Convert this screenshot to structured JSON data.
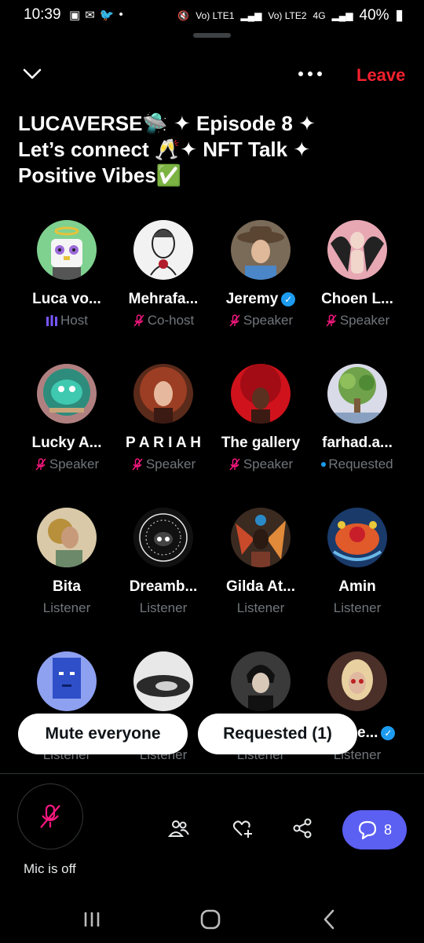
{
  "status_bar": {
    "time": "10:39",
    "net_1": "Vo) LTE1",
    "net_2": "Vo) LTE2",
    "net_3": "4G",
    "battery": "40%"
  },
  "header": {
    "leave_label": "Leave"
  },
  "title": {
    "line1": "LUCAVERSE🛸 ✦ Episode 8 ✦",
    "line2": "Let’s connect 🥂✦ NFT Talk ✦",
    "line3": "Positive Vibes✅"
  },
  "participants": [
    {
      "name": "Luca vo...",
      "role": "Host",
      "role_icon": "speaking-bars-icon",
      "avatar_bg": "#7fd18f"
    },
    {
      "name": "Mehrafa...",
      "role": "Co-host",
      "role_icon": "mic-off-icon",
      "avatar_bg": "#f2f2f2"
    },
    {
      "name": "Jeremy",
      "role": "Speaker",
      "role_icon": "mic-off-icon",
      "verified": true,
      "avatar_bg": "#6a5a4a"
    },
    {
      "name": "Choen L...",
      "role": "Speaker",
      "role_icon": "mic-off-icon",
      "avatar_bg": "#e7a8b3"
    },
    {
      "name": "Lucky A...",
      "role": "Speaker",
      "role_icon": "mic-off-icon",
      "avatar_bg": "#2e8c7c"
    },
    {
      "name": "P A R I A H",
      "role": "Speaker",
      "role_icon": "mic-off-icon",
      "avatar_bg": "#8a3b27"
    },
    {
      "name": "The gallery",
      "role": "Speaker",
      "role_icon": "mic-off-icon",
      "avatar_bg": "#c4151c"
    },
    {
      "name": "farhad.a...",
      "role": "Requested",
      "role_icon": "blue-dot-icon",
      "avatar_bg": "#6fa24b"
    },
    {
      "name": "Bita",
      "role": "Listener",
      "avatar_bg": "#c9a57a"
    },
    {
      "name": "Dreamb...",
      "role": "Listener",
      "avatar_bg": "#111111"
    },
    {
      "name": "Gilda At...",
      "role": "Listener",
      "avatar_bg": "#b3502a"
    },
    {
      "name": "Amin",
      "role": "Listener",
      "avatar_bg": "#2e6fbf"
    },
    {
      "name": "",
      "role": "Listener",
      "avatar_bg": "#8ea0f0"
    },
    {
      "name": "",
      "role": "Listener",
      "avatar_bg": "#bdbdbd"
    },
    {
      "name": "",
      "role": "Listener",
      "avatar_bg": "#4a4a4a"
    },
    {
      "name": "e...",
      "role": "Listener",
      "verified": true,
      "avatar_bg": "#8a6a5a"
    }
  ],
  "actions": {
    "mute_everyone": "Mute everyone",
    "requested": "Requested (1)"
  },
  "bottom": {
    "mic_label": "Mic is off",
    "chat_count": "8"
  },
  "colors": {
    "leave": "#f4212e",
    "chat_button": "#5b5ff2",
    "muted_icon": "#f91880",
    "verified": "#1d9bf0"
  }
}
